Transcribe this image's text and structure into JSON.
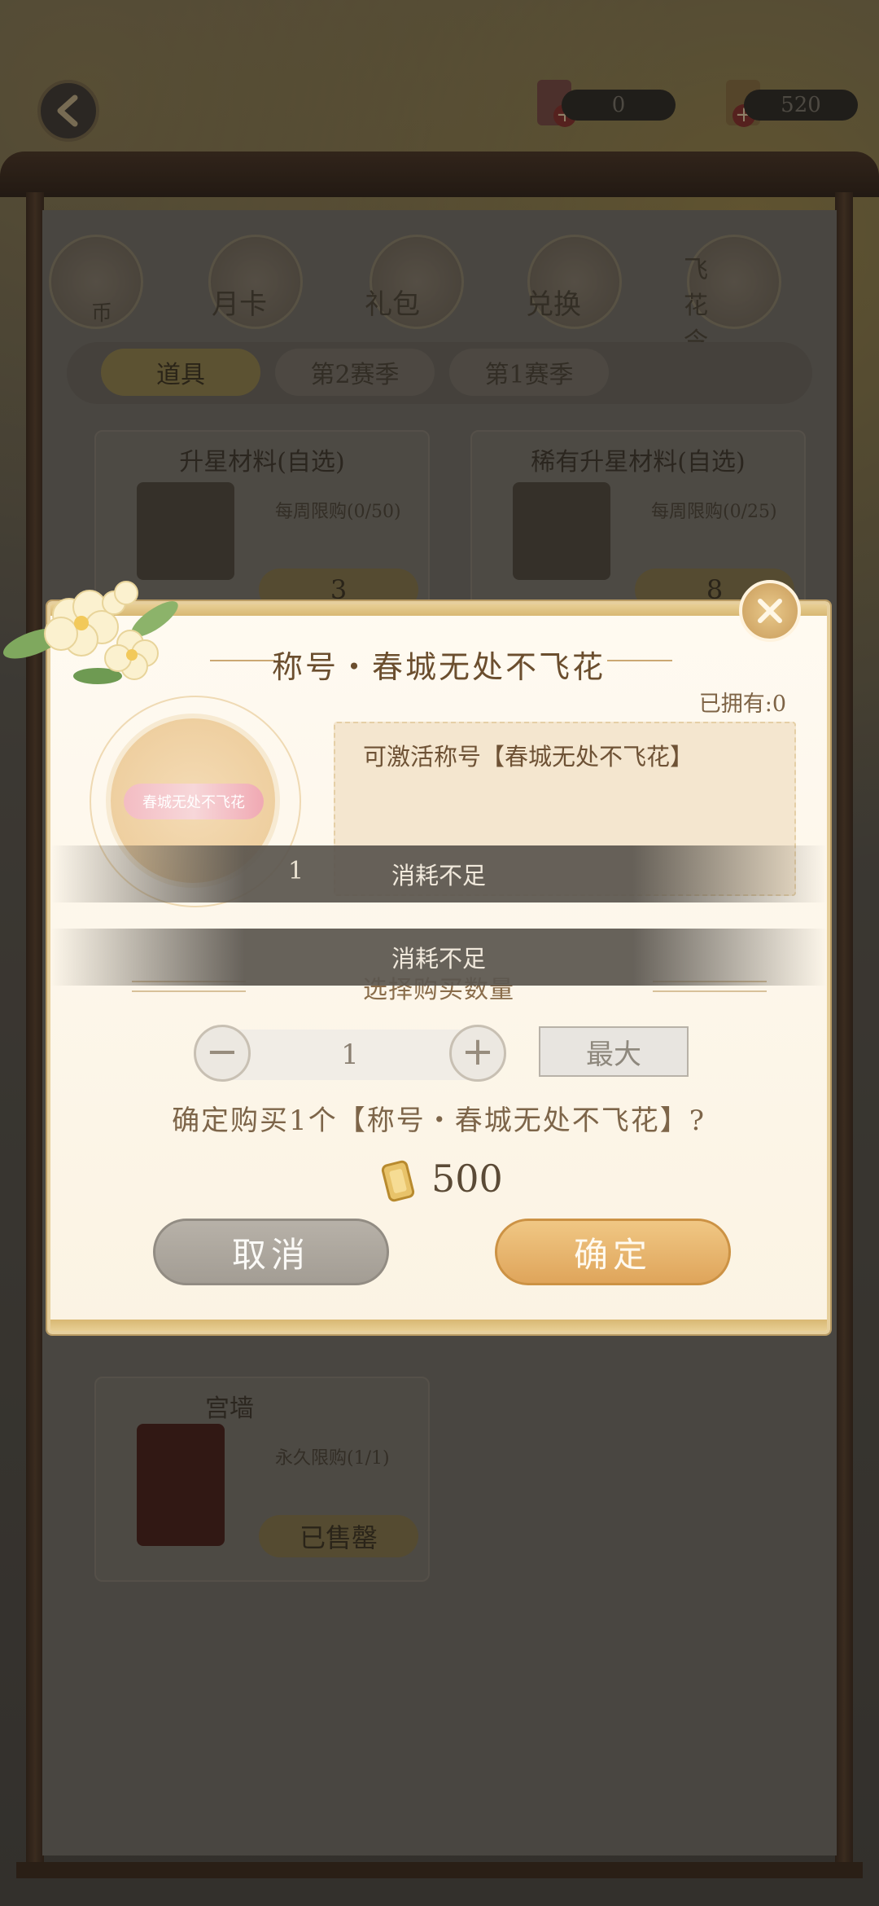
{
  "topbar": {
    "back_icon": "back-arrow-icon",
    "currency_1": {
      "icon": "red-ticket-icon",
      "value": "0"
    },
    "currency_2": {
      "icon": "gold-token-icon",
      "value": "520"
    }
  },
  "shop": {
    "tabs": [
      {
        "label": "币"
      },
      {
        "label": "月卡"
      },
      {
        "label": "礼包"
      },
      {
        "label": "兑换"
      },
      {
        "label": "飞花令"
      }
    ],
    "subtabs": [
      "道具",
      "第2赛季",
      "第1赛季"
    ],
    "items": [
      {
        "name": "升星材料(自选)",
        "limit": "每周限购(0/50)",
        "price": "3"
      },
      {
        "name": "稀有升星材料(自选)",
        "limit": "每周限购(0/25)",
        "price": "8"
      },
      {
        "name": "宫墙",
        "limit": "永久限购(1/1)",
        "price": "已售罄"
      }
    ]
  },
  "modal": {
    "title": "称号・春城无处不飞花",
    "owned": "已拥有:0",
    "preview_tag": "春城无处不飞花",
    "description": "可激活称号【春城无处不飞花】",
    "toast_1": "消耗不足",
    "toast_1_number": "1",
    "toast_2": "消耗不足",
    "quantity_title": "选择购买数量",
    "minus_label": "−",
    "plus_label": "+",
    "quantity": "1",
    "max_label": "最大",
    "confirm_text": "确定购买1个【称号・春城无处不飞花】?",
    "price": "500",
    "cancel_label": "取消",
    "ok_label": "确定"
  },
  "colors": {
    "accent_gold": "#dfa55b",
    "title_brown": "#6b4e2e",
    "cancel_grey": "#a39d94"
  }
}
